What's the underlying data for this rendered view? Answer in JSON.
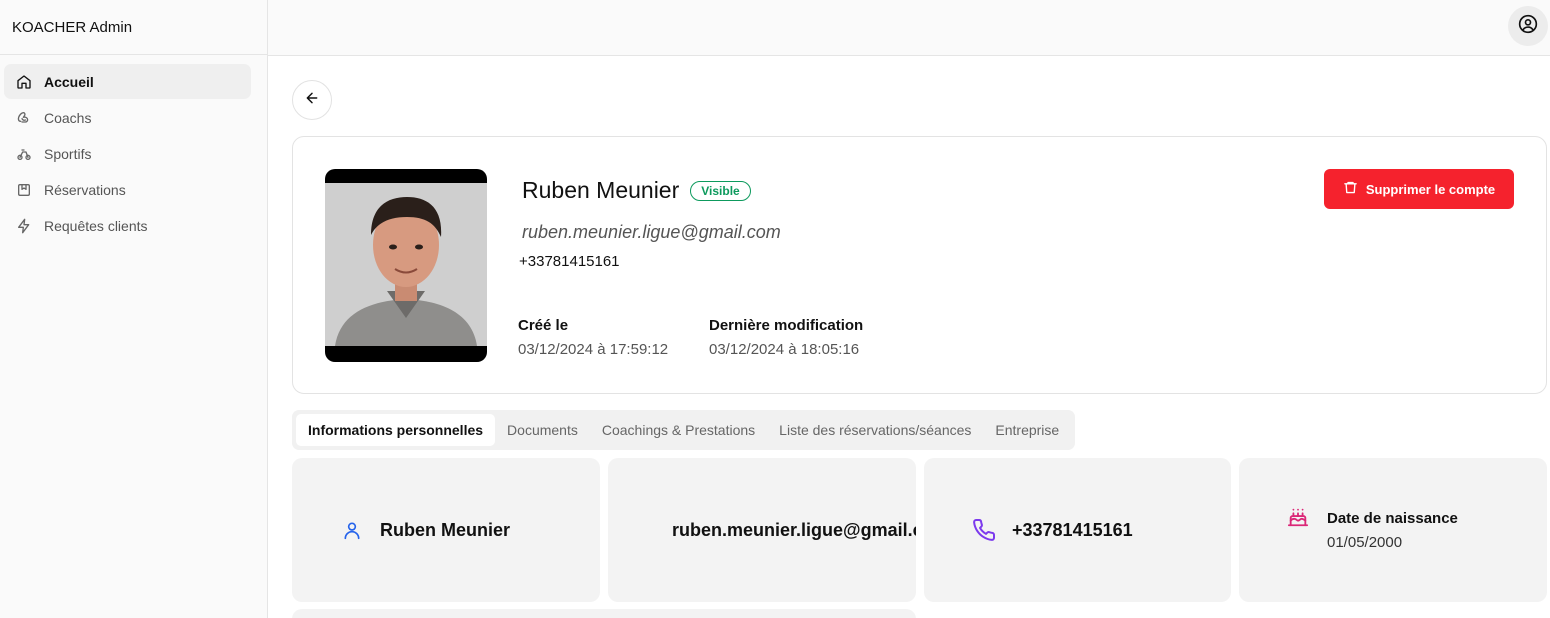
{
  "app": {
    "title": "KOACHER Admin"
  },
  "sidebar": {
    "items": [
      {
        "label": "Accueil",
        "icon": "home-icon",
        "active": true
      },
      {
        "label": "Coachs",
        "icon": "dumbbell-icon",
        "active": false
      },
      {
        "label": "Sportifs",
        "icon": "bike-icon",
        "active": false
      },
      {
        "label": "Réservations",
        "icon": "book-icon",
        "active": false
      },
      {
        "label": "Requêtes clients",
        "icon": "zap-icon",
        "active": false
      }
    ]
  },
  "profile": {
    "name": "Ruben Meunier",
    "status": "Visible",
    "email": "ruben.meunier.ligue@gmail.com",
    "phone": "+33781415161",
    "created_label": "Créé le",
    "created_value": "03/12/2024 à 17:59:12",
    "modified_label": "Dernière modification",
    "modified_value": "03/12/2024 à 18:05:16",
    "delete_label": "Supprimer le compte"
  },
  "tabs": [
    {
      "label": "Informations personnelles",
      "active": true
    },
    {
      "label": "Documents",
      "active": false
    },
    {
      "label": "Coachings & Prestations",
      "active": false
    },
    {
      "label": "Liste des réservations/séances",
      "active": false
    },
    {
      "label": "Entreprise",
      "active": false
    }
  ],
  "info": {
    "name": "Ruben Meunier",
    "email": "ruben.meunier.ligue@gmail.com",
    "phone": "+33781415161",
    "dob_label": "Date de naissance",
    "dob_value": "01/05/2000"
  },
  "colors": {
    "danger": "#f5222d",
    "success": "#0d9a5d",
    "user_icon": "#2563eb",
    "phone_icon": "#7c3aed",
    "cake_icon": "#db2777"
  }
}
